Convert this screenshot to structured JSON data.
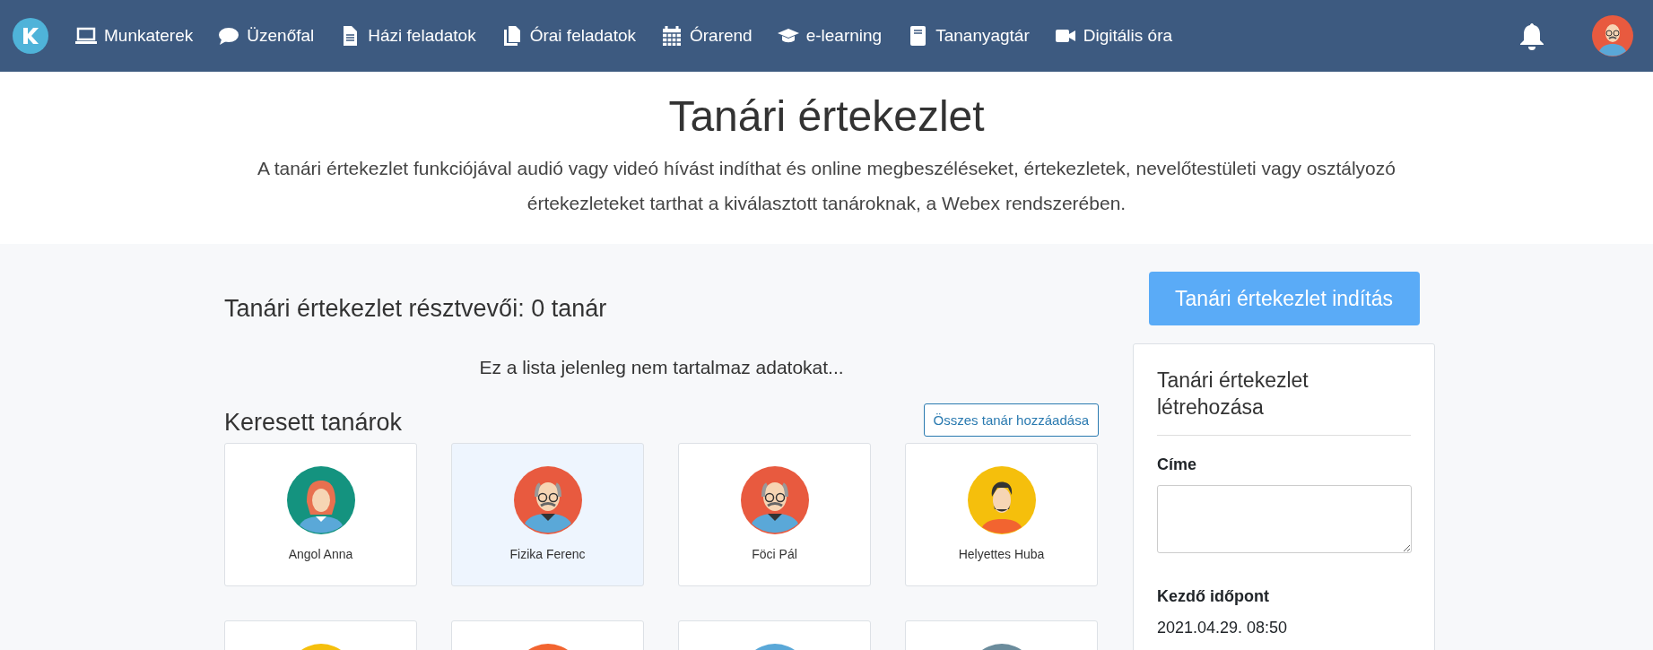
{
  "nav": {
    "items": [
      {
        "kind": "laptop",
        "label": "Munkaterek"
      },
      {
        "kind": "chat",
        "label": "Üzenőfal"
      },
      {
        "kind": "file",
        "label": "Házi feladatok"
      },
      {
        "kind": "files",
        "label": "Órai feladatok"
      },
      {
        "kind": "calendar",
        "label": "Órarend"
      },
      {
        "kind": "cap",
        "label": "e-learning"
      },
      {
        "kind": "book",
        "label": "Tananyagtár"
      },
      {
        "kind": "video",
        "label": "Digitális óra"
      }
    ]
  },
  "header": {
    "title": "Tanári értekezlet",
    "description": "A tanári értekezlet funkciójával audió vagy videó hívást indíthat és online megbeszéléseket, értekezletek, nevelőtestületi vagy osztályozó értekezleteket tarthat a kiválasztott tanároknak, a Webex rendszerében."
  },
  "participants": {
    "heading": "Tanári értekezlet résztvevői: 0 tanár",
    "empty_message": "Ez a lista jelenleg nem tartalmaz adatokat..."
  },
  "search_results": {
    "heading": "Keresett tanárok",
    "add_all_button": "Összes tanár hozzáadása",
    "teachers": [
      {
        "name": "Angol Anna",
        "kind": "woman",
        "color": "#14937f",
        "selected": false
      },
      {
        "name": "Fizika Ferenc",
        "kind": "bald-man",
        "color": "#e85a3f",
        "selected": true
      },
      {
        "name": "Föci Pál",
        "kind": "bald-man",
        "color": "#e85a3f",
        "selected": false
      },
      {
        "name": "Helyettes Huba",
        "kind": "bearded-man",
        "color": "#f5bf0c",
        "selected": false
      },
      {
        "kind": "cut",
        "color": "#f5bf0c",
        "selected": false
      },
      {
        "kind": "cut",
        "color": "#f26430",
        "selected": false
      },
      {
        "kind": "cut",
        "color": "#5aa8d8",
        "selected": false
      },
      {
        "kind": "cut",
        "color": "#6b8c9c",
        "selected": false
      }
    ]
  },
  "start_button": "Tanári értekezlet indítás",
  "create_panel": {
    "title": "Tanári értekezlet létrehozása",
    "title_label": "Címe",
    "start_label": "Kezdő időpont",
    "start_value": "2021.04.29. 08:50"
  }
}
